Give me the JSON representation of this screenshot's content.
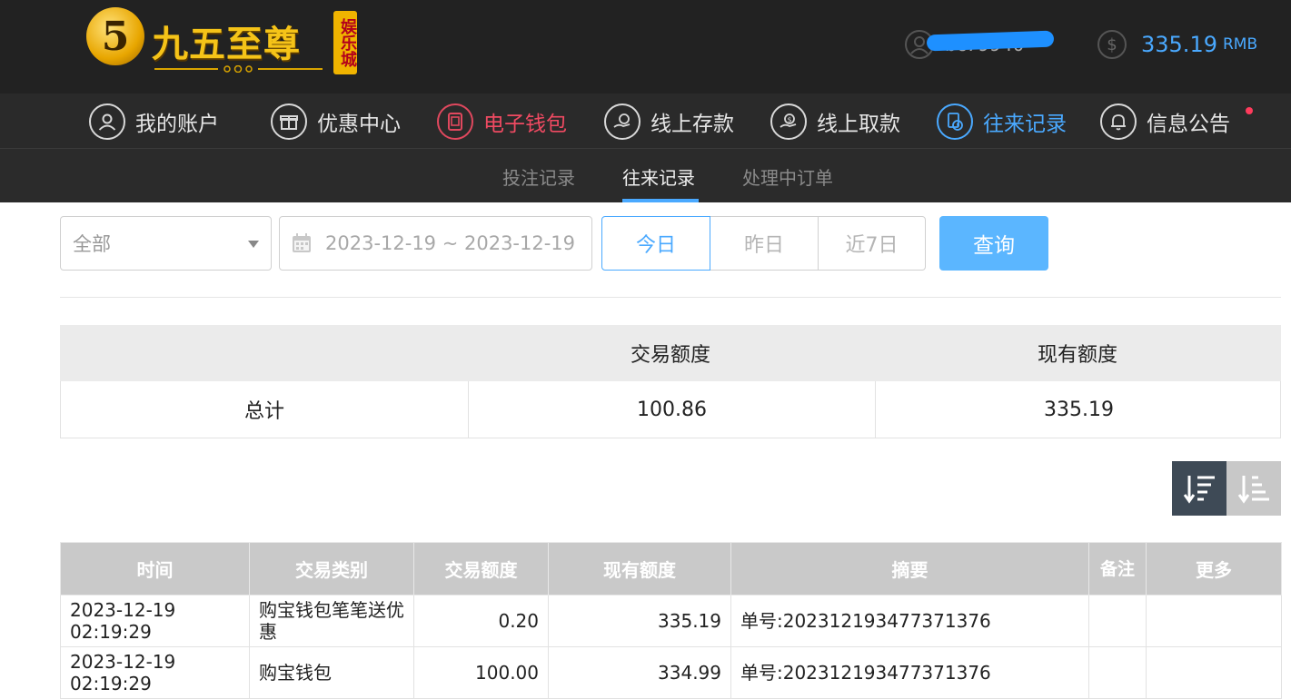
{
  "header": {
    "logo_text": "九五至尊",
    "logo_vertical": "娱乐城",
    "logo_badge": "5",
    "username": "bc79940",
    "balance": "335.19",
    "balance_unit": "RMB"
  },
  "main_nav": [
    {
      "label": "我的账户",
      "icon": "user-icon"
    },
    {
      "label": "优惠中心",
      "icon": "gift-icon"
    },
    {
      "label": "电子钱包",
      "icon": "wallet-icon"
    },
    {
      "label": "线上存款",
      "icon": "deposit-icon"
    },
    {
      "label": "线上取款",
      "icon": "withdraw-icon"
    },
    {
      "label": "往来记录",
      "icon": "records-icon"
    },
    {
      "label": "信息公告",
      "icon": "bell-icon"
    }
  ],
  "sub_nav": [
    {
      "label": "投注记录"
    },
    {
      "label": "往来记录"
    },
    {
      "label": "处理中订单"
    }
  ],
  "filters": {
    "type_select": "全部",
    "date_range": "2023-12-19 ~ 2023-12-19",
    "quick": [
      "今日",
      "昨日",
      "近7日"
    ],
    "query_label": "查询"
  },
  "summary": {
    "headers": [
      "",
      "交易额度",
      "现有额度"
    ],
    "row": {
      "label": "总计",
      "trade_amount": "100.86",
      "current_amount": "335.19"
    }
  },
  "records": {
    "headers": [
      "时间",
      "交易类别",
      "交易额度",
      "现有额度",
      "摘要",
      "备注",
      "更多"
    ],
    "rows": [
      [
        "2023-12-19 02:19:29",
        "购宝钱包笔笔送优惠",
        "0.20",
        "335.19",
        "单号:202312193477371376",
        "",
        ""
      ],
      [
        "2023-12-19 02:19:29",
        "购宝钱包",
        "100.00",
        "334.99",
        "单号:202312193477371376",
        "",
        ""
      ]
    ]
  },
  "colors": {
    "accent_blue": "#4aa9ff",
    "accent_red": "#f04a62",
    "header_bg": "#222222"
  }
}
